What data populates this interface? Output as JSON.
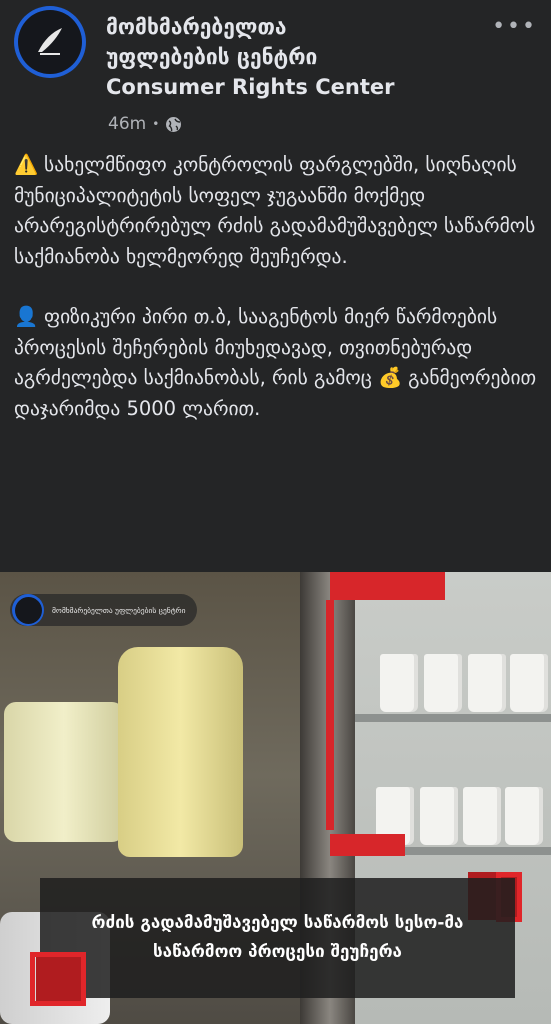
{
  "header": {
    "author_line1": "მომხმარებელთა",
    "author_line2": "უფლებების ცენტრი",
    "author_line3": "Consumer Rights Center",
    "time": "46m",
    "separator": "•",
    "privacy_icon": "globe-icon",
    "more_label": "•••",
    "avatar_icon": "consumer-rights-center-logo"
  },
  "post": {
    "warning_emoji": "⚠️",
    "paragraph1": "სახელმწიფო კონტროლის ფარგლებში, სიღნაღის მუნიციპალიტეტის სოფელ ჯუგაანში მოქმედ არარეგისტრირებულ რძის გადამამუშავებელ საწარმოს საქმიანობა ხელმეორედ შეუჩერდა.",
    "person_emoji": "👤",
    "paragraph2_part1": "ფიზიკური პირი თ.ბ, სააგენტოს მიერ წარმოების პროცესის შეჩერების მიუხედავად, თვითნებურად აგრძელებდა საქმიანობას, რის გამოც",
    "money_emoji": "💰",
    "paragraph2_part2": "განმეორებით დაჯარიმდა 5000 ლარით."
  },
  "image": {
    "watermark_text": "მომხმარებელთა უფლებების ცენტრი",
    "caption": "რძის გადამამუშავებელ საწარმოს სესო-მა საწარმოო პროცესი შეუჩერა"
  },
  "colors": {
    "background": "#242526",
    "text": "#e4e6eb",
    "secondary_text": "#b0b3b8",
    "avatar_ring": "#1f5fd6",
    "accent_red": "#d7262a"
  }
}
